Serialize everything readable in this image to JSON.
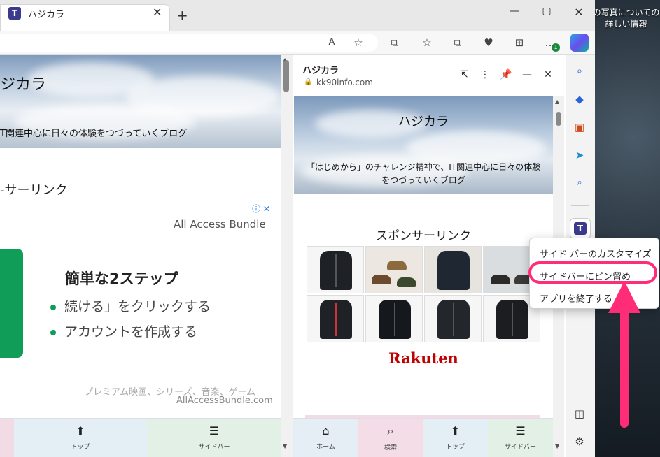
{
  "desktop": {
    "caption": "の写真についての詳しい情報"
  },
  "tab": {
    "title": "ハジカラ",
    "favicon_letter": "T",
    "close": "✕",
    "new_tab": "+"
  },
  "window": {
    "minimize": "—",
    "maximize": "▢",
    "close": "✕"
  },
  "toolbar": {
    "read_aloud": "A",
    "favorite": "☆",
    "split_screen": "⧉",
    "favorites": "☆",
    "collections": "⧉",
    "health": "♥",
    "extensions": "⊞",
    "more": "…",
    "notification_count": "1"
  },
  "page": {
    "hero_title": "ジカラ",
    "hero_sub": "T関連中心に日々の体験をつづっていくブログ",
    "sponsor_link": "-サーリンク",
    "ad": {
      "info": "ⓘ ✕",
      "title": "All Access Bundle",
      "heading": "簡単な2ステップ",
      "bullets": [
        "続ける」をクリックする",
        "アカウントを作成する"
      ],
      "description": "プレミアム映画、シリーズ、音楽、ゲーム",
      "domain": "AllAccessBundle.com"
    },
    "bottom_nav": [
      {
        "icon": "⬆",
        "label": "トップ"
      },
      {
        "icon": "☰",
        "label": "サイドバー"
      }
    ]
  },
  "side_panel": {
    "title": "ハジカラ",
    "url": "kk90info.com",
    "hero_title": "ハジカラ",
    "hero_sub_1": "「はじめから」のチャレンジ精神で、IT関連中心に日々の体験",
    "hero_sub_2": "をつづっていくブログ",
    "sponsor": "スポンサーリンク",
    "ad_info": "ⓘ",
    "rakuten": "Rakuten",
    "bottom_nav": [
      {
        "icon": "⌂",
        "label": "ホーム"
      },
      {
        "icon": "⌕",
        "label": "検索"
      },
      {
        "icon": "⬆",
        "label": "トップ"
      },
      {
        "icon": "☰",
        "label": "サイドバー"
      }
    ]
  },
  "edge_sidebar": {
    "search": "⌕",
    "shopping": "◆",
    "tools": "▣",
    "games": "➤",
    "bing": "⌕",
    "app_letter": "T",
    "panel": "◫",
    "settings": "⚙"
  },
  "context_menu": {
    "items": [
      "サイド バーのカスタマイズ",
      "サイドバーにピン留め",
      "アプリを終了する"
    ]
  },
  "colors": {
    "highlight": "#ff2d78",
    "brand": "#3b3a8c",
    "ad_green": "#0f9d58"
  }
}
